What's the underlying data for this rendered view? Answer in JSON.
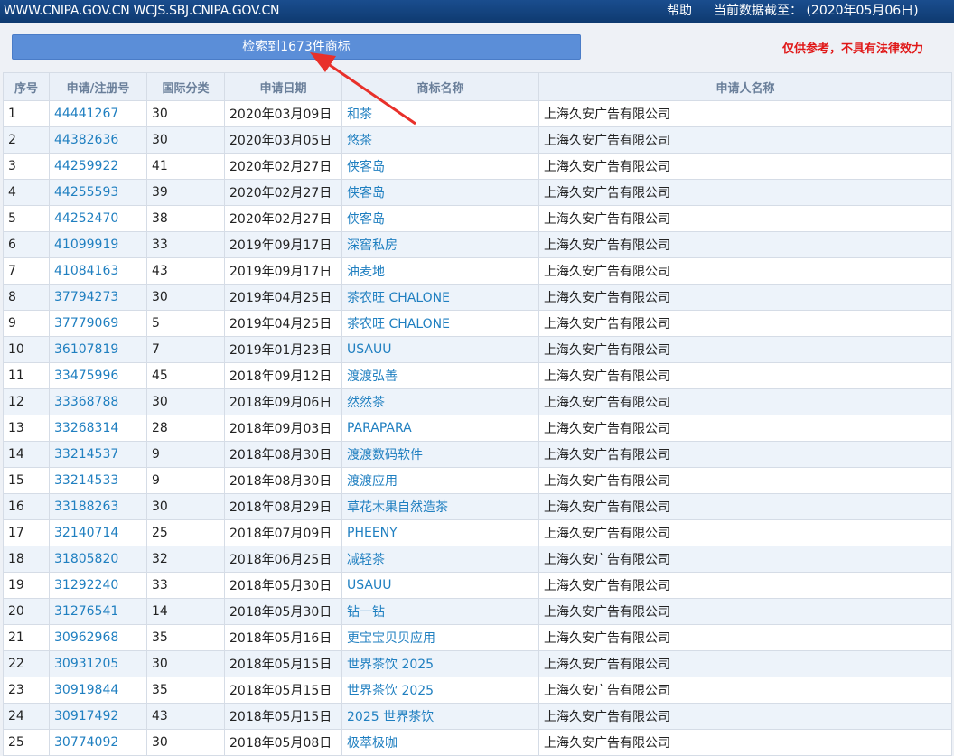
{
  "header": {
    "sites": "WWW.CNIPA.GOV.CN WCJS.SBJ.CNIPA.GOV.CN",
    "help": "帮助",
    "asof": "当前数据截至：  (2020年05月06日)"
  },
  "result_button": "检索到1673件商标",
  "disclaimer": "仅供参考，不具有法律效力",
  "colors": {
    "topbar": "#0e3a70",
    "button": "#5b8ed8",
    "link": "#1f7fc0",
    "warning": "#e01818",
    "arrow": "#e8302a"
  },
  "table": {
    "headers": [
      "序号",
      "申请/注册号",
      "国际分类",
      "申请日期",
      "商标名称",
      "申请人名称"
    ],
    "rows": [
      [
        "1",
        "44441267",
        "30",
        "2020年03月09日",
        "和茶",
        "上海久安广告有限公司"
      ],
      [
        "2",
        "44382636",
        "30",
        "2020年03月05日",
        "悠茶",
        "上海久安广告有限公司"
      ],
      [
        "3",
        "44259922",
        "41",
        "2020年02月27日",
        "侠客岛",
        "上海久安广告有限公司"
      ],
      [
        "4",
        "44255593",
        "39",
        "2020年02月27日",
        "侠客岛",
        "上海久安广告有限公司"
      ],
      [
        "5",
        "44252470",
        "38",
        "2020年02月27日",
        "侠客岛",
        "上海久安广告有限公司"
      ],
      [
        "6",
        "41099919",
        "33",
        "2019年09月17日",
        "深窖私房",
        "上海久安广告有限公司"
      ],
      [
        "7",
        "41084163",
        "43",
        "2019年09月17日",
        "油麦地",
        "上海久安广告有限公司"
      ],
      [
        "8",
        "37794273",
        "30",
        "2019年04月25日",
        "茶农旺 CHALONE",
        "上海久安广告有限公司"
      ],
      [
        "9",
        "37779069",
        "5",
        "2019年04月25日",
        "茶农旺 CHALONE",
        "上海久安广告有限公司"
      ],
      [
        "10",
        "36107819",
        "7",
        "2019年01月23日",
        "USAUU",
        "上海久安广告有限公司"
      ],
      [
        "11",
        "33475996",
        "45",
        "2018年09月12日",
        "渡渡弘善",
        "上海久安广告有限公司"
      ],
      [
        "12",
        "33368788",
        "30",
        "2018年09月06日",
        "然然茶",
        "上海久安广告有限公司"
      ],
      [
        "13",
        "33268314",
        "28",
        "2018年09月03日",
        "PARAPARA",
        "上海久安广告有限公司"
      ],
      [
        "14",
        "33214537",
        "9",
        "2018年08月30日",
        "渡渡数码软件",
        "上海久安广告有限公司"
      ],
      [
        "15",
        "33214533",
        "9",
        "2018年08月30日",
        "渡渡应用",
        "上海久安广告有限公司"
      ],
      [
        "16",
        "33188263",
        "30",
        "2018年08月29日",
        "草花木果自然造茶",
        "上海久安广告有限公司"
      ],
      [
        "17",
        "32140714",
        "25",
        "2018年07月09日",
        "PHEENY",
        "上海久安广告有限公司"
      ],
      [
        "18",
        "31805820",
        "32",
        "2018年06月25日",
        "减轻茶",
        "上海久安广告有限公司"
      ],
      [
        "19",
        "31292240",
        "33",
        "2018年05月30日",
        "USAUU",
        "上海久安广告有限公司"
      ],
      [
        "20",
        "31276541",
        "14",
        "2018年05月30日",
        "钻一钻",
        "上海久安广告有限公司"
      ],
      [
        "21",
        "30962968",
        "35",
        "2018年05月16日",
        "更宝宝贝贝应用",
        "上海久安广告有限公司"
      ],
      [
        "22",
        "30931205",
        "30",
        "2018年05月15日",
        "世界茶饮 2025",
        "上海久安广告有限公司"
      ],
      [
        "23",
        "30919844",
        "35",
        "2018年05月15日",
        "世界茶饮 2025",
        "上海久安广告有限公司"
      ],
      [
        "24",
        "30917492",
        "43",
        "2018年05月15日",
        "2025 世界茶饮",
        "上海久安广告有限公司"
      ],
      [
        "25",
        "30774092",
        "30",
        "2018年05月08日",
        "极萃极咖",
        "上海久安广告有限公司"
      ]
    ]
  }
}
